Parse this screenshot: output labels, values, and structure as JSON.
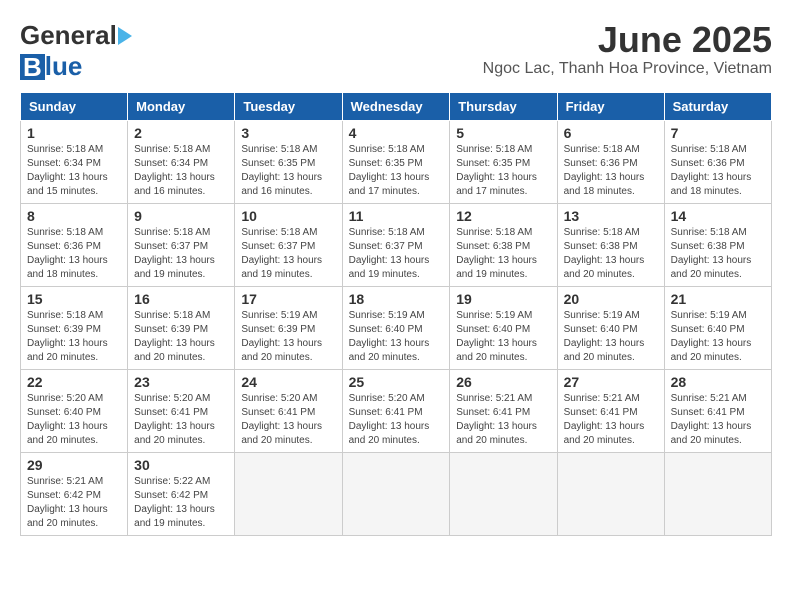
{
  "header": {
    "logo_general": "General",
    "logo_blue": "Blue",
    "title": "June 2025",
    "subtitle": "Ngoc Lac, Thanh Hoa Province, Vietnam"
  },
  "calendar": {
    "days_of_week": [
      "Sunday",
      "Monday",
      "Tuesday",
      "Wednesday",
      "Thursday",
      "Friday",
      "Saturday"
    ],
    "weeks": [
      [
        null,
        {
          "day": "2",
          "sunrise": "Sunrise: 5:18 AM",
          "sunset": "Sunset: 6:34 PM",
          "daylight": "Daylight: 13 hours and 16 minutes."
        },
        {
          "day": "3",
          "sunrise": "Sunrise: 5:18 AM",
          "sunset": "Sunset: 6:35 PM",
          "daylight": "Daylight: 13 hours and 16 minutes."
        },
        {
          "day": "4",
          "sunrise": "Sunrise: 5:18 AM",
          "sunset": "Sunset: 6:35 PM",
          "daylight": "Daylight: 13 hours and 17 minutes."
        },
        {
          "day": "5",
          "sunrise": "Sunrise: 5:18 AM",
          "sunset": "Sunset: 6:35 PM",
          "daylight": "Daylight: 13 hours and 17 minutes."
        },
        {
          "day": "6",
          "sunrise": "Sunrise: 5:18 AM",
          "sunset": "Sunset: 6:36 PM",
          "daylight": "Daylight: 13 hours and 18 minutes."
        },
        {
          "day": "7",
          "sunrise": "Sunrise: 5:18 AM",
          "sunset": "Sunset: 6:36 PM",
          "daylight": "Daylight: 13 hours and 18 minutes."
        }
      ],
      [
        {
          "day": "1",
          "sunrise": "Sunrise: 5:18 AM",
          "sunset": "Sunset: 6:34 PM",
          "daylight": "Daylight: 13 hours and 15 minutes."
        },
        null,
        null,
        null,
        null,
        null,
        null
      ],
      [
        {
          "day": "8",
          "sunrise": "Sunrise: 5:18 AM",
          "sunset": "Sunset: 6:36 PM",
          "daylight": "Daylight: 13 hours and 18 minutes."
        },
        {
          "day": "9",
          "sunrise": "Sunrise: 5:18 AM",
          "sunset": "Sunset: 6:37 PM",
          "daylight": "Daylight: 13 hours and 19 minutes."
        },
        {
          "day": "10",
          "sunrise": "Sunrise: 5:18 AM",
          "sunset": "Sunset: 6:37 PM",
          "daylight": "Daylight: 13 hours and 19 minutes."
        },
        {
          "day": "11",
          "sunrise": "Sunrise: 5:18 AM",
          "sunset": "Sunset: 6:37 PM",
          "daylight": "Daylight: 13 hours and 19 minutes."
        },
        {
          "day": "12",
          "sunrise": "Sunrise: 5:18 AM",
          "sunset": "Sunset: 6:38 PM",
          "daylight": "Daylight: 13 hours and 19 minutes."
        },
        {
          "day": "13",
          "sunrise": "Sunrise: 5:18 AM",
          "sunset": "Sunset: 6:38 PM",
          "daylight": "Daylight: 13 hours and 20 minutes."
        },
        {
          "day": "14",
          "sunrise": "Sunrise: 5:18 AM",
          "sunset": "Sunset: 6:38 PM",
          "daylight": "Daylight: 13 hours and 20 minutes."
        }
      ],
      [
        {
          "day": "15",
          "sunrise": "Sunrise: 5:18 AM",
          "sunset": "Sunset: 6:39 PM",
          "daylight": "Daylight: 13 hours and 20 minutes."
        },
        {
          "day": "16",
          "sunrise": "Sunrise: 5:18 AM",
          "sunset": "Sunset: 6:39 PM",
          "daylight": "Daylight: 13 hours and 20 minutes."
        },
        {
          "day": "17",
          "sunrise": "Sunrise: 5:19 AM",
          "sunset": "Sunset: 6:39 PM",
          "daylight": "Daylight: 13 hours and 20 minutes."
        },
        {
          "day": "18",
          "sunrise": "Sunrise: 5:19 AM",
          "sunset": "Sunset: 6:40 PM",
          "daylight": "Daylight: 13 hours and 20 minutes."
        },
        {
          "day": "19",
          "sunrise": "Sunrise: 5:19 AM",
          "sunset": "Sunset: 6:40 PM",
          "daylight": "Daylight: 13 hours and 20 minutes."
        },
        {
          "day": "20",
          "sunrise": "Sunrise: 5:19 AM",
          "sunset": "Sunset: 6:40 PM",
          "daylight": "Daylight: 13 hours and 20 minutes."
        },
        {
          "day": "21",
          "sunrise": "Sunrise: 5:19 AM",
          "sunset": "Sunset: 6:40 PM",
          "daylight": "Daylight: 13 hours and 20 minutes."
        }
      ],
      [
        {
          "day": "22",
          "sunrise": "Sunrise: 5:20 AM",
          "sunset": "Sunset: 6:40 PM",
          "daylight": "Daylight: 13 hours and 20 minutes."
        },
        {
          "day": "23",
          "sunrise": "Sunrise: 5:20 AM",
          "sunset": "Sunset: 6:41 PM",
          "daylight": "Daylight: 13 hours and 20 minutes."
        },
        {
          "day": "24",
          "sunrise": "Sunrise: 5:20 AM",
          "sunset": "Sunset: 6:41 PM",
          "daylight": "Daylight: 13 hours and 20 minutes."
        },
        {
          "day": "25",
          "sunrise": "Sunrise: 5:20 AM",
          "sunset": "Sunset: 6:41 PM",
          "daylight": "Daylight: 13 hours and 20 minutes."
        },
        {
          "day": "26",
          "sunrise": "Sunrise: 5:21 AM",
          "sunset": "Sunset: 6:41 PM",
          "daylight": "Daylight: 13 hours and 20 minutes."
        },
        {
          "day": "27",
          "sunrise": "Sunrise: 5:21 AM",
          "sunset": "Sunset: 6:41 PM",
          "daylight": "Daylight: 13 hours and 20 minutes."
        },
        {
          "day": "28",
          "sunrise": "Sunrise: 5:21 AM",
          "sunset": "Sunset: 6:41 PM",
          "daylight": "Daylight: 13 hours and 20 minutes."
        }
      ],
      [
        {
          "day": "29",
          "sunrise": "Sunrise: 5:21 AM",
          "sunset": "Sunset: 6:42 PM",
          "daylight": "Daylight: 13 hours and 20 minutes."
        },
        {
          "day": "30",
          "sunrise": "Sunrise: 5:22 AM",
          "sunset": "Sunset: 6:42 PM",
          "daylight": "Daylight: 13 hours and 19 minutes."
        },
        null,
        null,
        null,
        null,
        null
      ]
    ]
  }
}
